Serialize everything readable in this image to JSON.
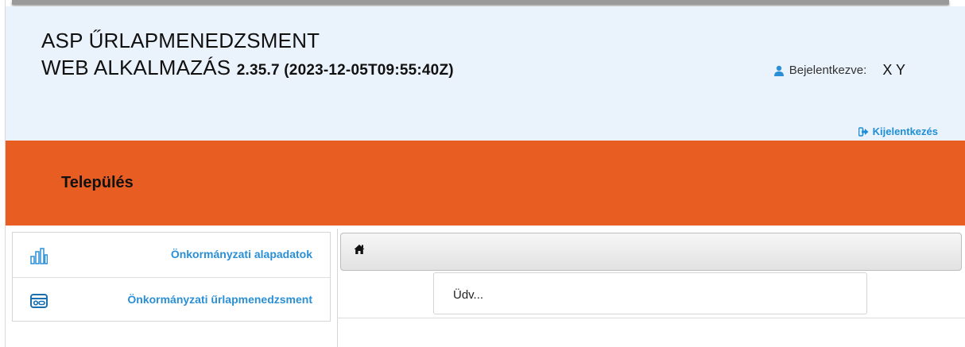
{
  "header": {
    "title_line1": "ASP ŰRLAPMENEDZSMENT",
    "title_line2": "WEB ALKALMAZÁS",
    "version": "2.35.7 (2023-12-05T09:55:40Z)",
    "logged_in_label": "Bejelentkezve:",
    "user_name": "X Y",
    "logout_label": "Kijelentkezés",
    "user_icon": "user-icon",
    "logout_icon": "sign-out-icon"
  },
  "banner": {
    "settlement_label": "Település",
    "color": "#e85e22"
  },
  "sidebar": {
    "items": [
      {
        "label": "Önkormányzati alapadatok",
        "icon": "bar-chart-icon"
      },
      {
        "label": "Önkormányzati űrlapmenedzsment",
        "icon": "id-card-icon"
      }
    ]
  },
  "breadcrumb": {
    "icon": "home-icon"
  },
  "content": {
    "welcome_text": "Üdv..."
  },
  "colors": {
    "accent": "#2b8fd5",
    "header_bg": "#eaf2fb",
    "banner": "#e85e22"
  }
}
